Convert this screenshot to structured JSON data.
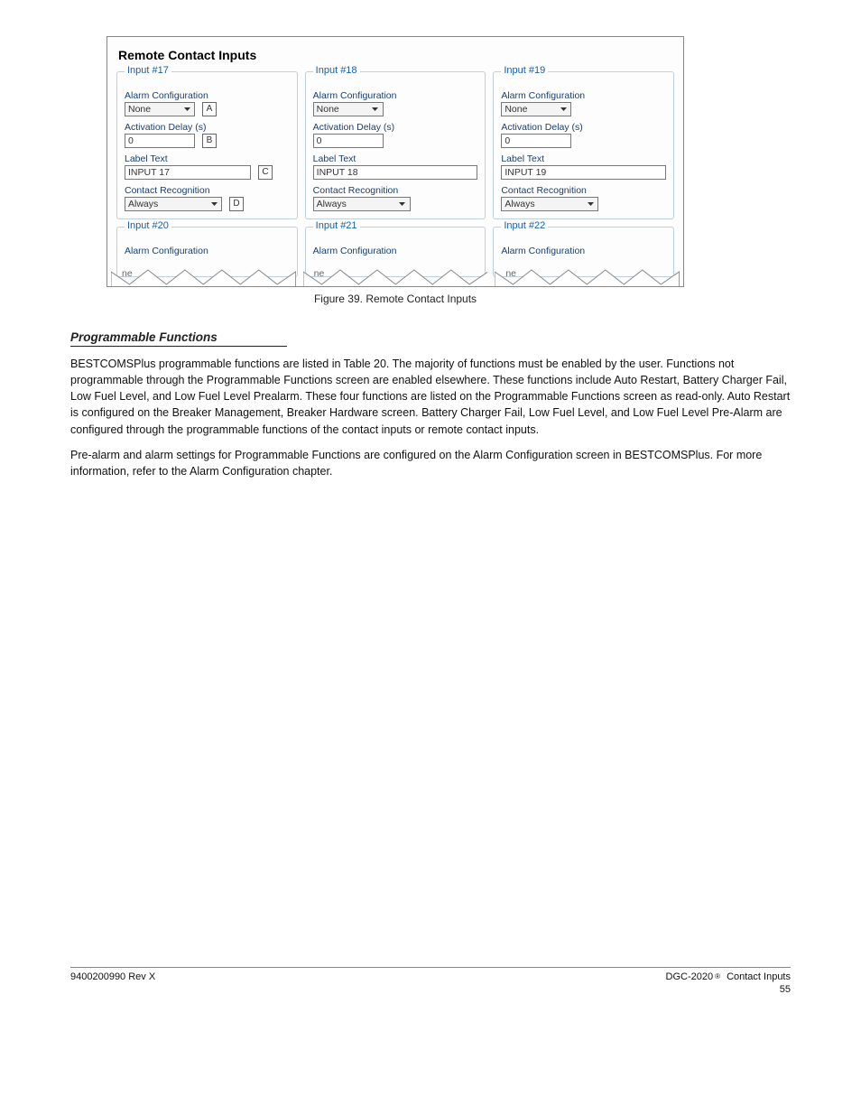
{
  "figure": {
    "title": "Remote Contact Inputs",
    "callouts": {
      "A": "A",
      "B": "B",
      "C": "C",
      "D": "D"
    },
    "labels": {
      "alarm_config": "Alarm Configuration",
      "activation_delay": "Activation Delay (s)",
      "label_text": "Label Text",
      "contact_recog": "Contact Recognition"
    },
    "values": {
      "none": "None",
      "zero": "0",
      "always": "Always"
    },
    "inputs_top": [
      {
        "legend": "Input #17",
        "label_value": "INPUT 17",
        "has_callouts": true
      },
      {
        "legend": "Input #18",
        "label_value": "INPUT 18",
        "has_callouts": false
      },
      {
        "legend": "Input #19",
        "label_value": "INPUT 19",
        "has_callouts": false
      }
    ],
    "inputs_bottom": [
      {
        "legend": "Input #20",
        "torn_text": "ne"
      },
      {
        "legend": "Input #21",
        "torn_text": "ne"
      },
      {
        "legend": "Input #22",
        "torn_text": "ne"
      }
    ]
  },
  "caption": "Figure 39. Remote Contact Inputs",
  "subhead": "Programmable Functions",
  "body": {
    "p1": "BESTCOMSPlus programmable functions are listed in Table 20. The majority of functions must be enabled by the user. Functions not programmable through the Programmable Functions screen are enabled elsewhere. These functions include Auto Restart, Battery Charger Fail, Low Fuel Level, and Low Fuel Level Prealarm. These four functions are listed on the Programmable Functions screen as read-only. Auto Restart is configured on the Breaker Management, Breaker Hardware screen. Battery Charger Fail, Low Fuel Level, and Low Fuel Level Pre-Alarm are configured through the programmable functions of the contact inputs or remote contact inputs.",
    "p2": "Pre-alarm and alarm settings for Programmable Functions are configured on the Alarm Configuration screen in BESTCOMSPlus. For more information, refer to the Alarm Configuration chapter."
  },
  "footer": {
    "left_number": "9400200990 Rev X",
    "right_product": "DGC-2020",
    "page_section": "Contact Inputs",
    "page_number": "55"
  }
}
